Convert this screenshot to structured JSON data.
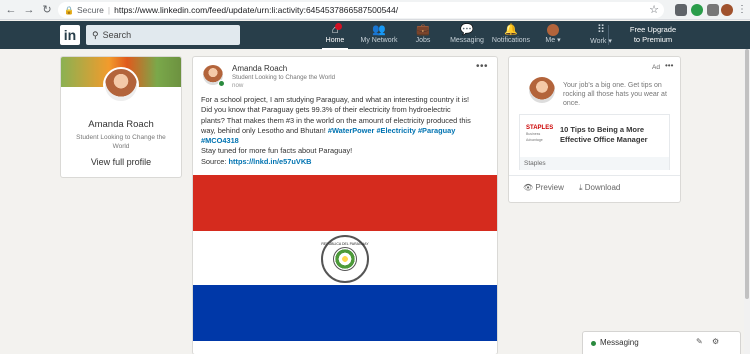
{
  "browser": {
    "secure_label": "Secure",
    "url": "https://www.linkedin.com/feed/update/urn:li:activity:6454537866587500544/"
  },
  "linkedin_nav": {
    "search_placeholder": "Search",
    "items": [
      {
        "label": "Home",
        "icon": "home-icon",
        "active": true,
        "badge": true
      },
      {
        "label": "My Network",
        "icon": "network-icon"
      },
      {
        "label": "Jobs",
        "icon": "briefcase-icon"
      },
      {
        "label": "Messaging",
        "icon": "chat-icon"
      },
      {
        "label": "Notifications",
        "icon": "bell-icon"
      },
      {
        "label": "Me",
        "icon": "avatar-icon"
      },
      {
        "label": "Work",
        "icon": "grid-icon"
      }
    ],
    "upgrade_line1": "Free Upgrade",
    "upgrade_line2": "to Premium"
  },
  "profile": {
    "name": "Amanda Roach",
    "headline": "Student Looking to Change the World",
    "view_link": "View full profile"
  },
  "post": {
    "author": "Amanda Roach",
    "headline": "Student Looking to Change the World",
    "time": "now",
    "line1": "For a school project, I am studying Paraguay, and what an interesting country it is!",
    "line2": "Did you know that Paraguay gets 99.3% of their electricity from hydroelectric",
    "line3": "plants?  That makes them #3 in the world on the amount of electricity produced this",
    "line4": "way, behind only Lesotho and Bhutan!",
    "tags": "#WaterPower #Electricity #Paraguay",
    "tag2": "#MCO4318",
    "line5": "Stay tuned for more fun facts about Paraguay!",
    "source_label": "Source:",
    "source_link": "https://lnkd.in/e57uVKB",
    "seal_text": "REPUBLICA DEL PARAGUAY"
  },
  "ad": {
    "label": "Ad",
    "copy": "Your job's a big one. Get tips on rocking all those hats you wear at once.",
    "brand": "STAPLES",
    "brand_sub": "Business Advantage",
    "title": "10 Tips to Being a More Effective Office Manager",
    "source": "Staples",
    "preview": "Preview",
    "download": "Download"
  },
  "messaging": {
    "label": "Messaging"
  }
}
